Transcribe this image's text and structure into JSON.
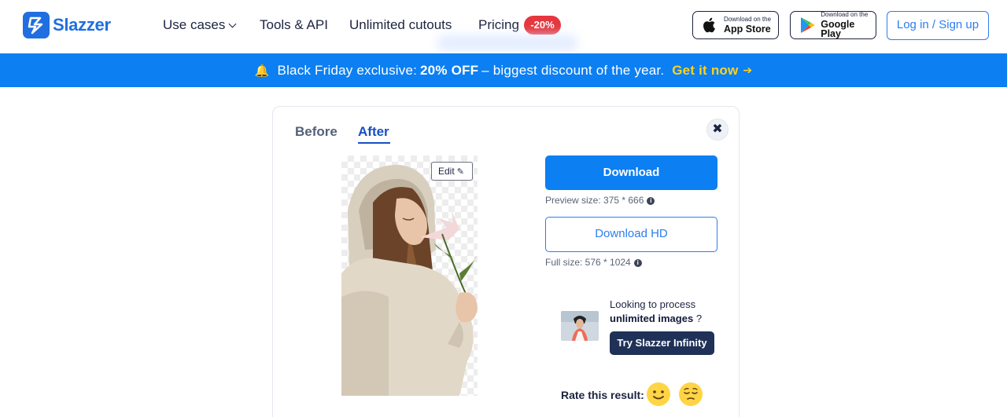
{
  "header": {
    "logo_text": "Slazzer",
    "nav": {
      "use_cases": "Use cases",
      "tools_api": "Tools & API",
      "unlimited_cutouts": "Unlimited cutouts",
      "pricing": "Pricing",
      "pricing_badge": "-20%"
    },
    "app_store": {
      "small": "Download on the",
      "big": "App Store"
    },
    "google_play": {
      "small": "Download on the",
      "big": "Google Play"
    },
    "login": "Log in / Sign up"
  },
  "banner": {
    "text_before": "Black Friday exclusive:",
    "highlight": "20% OFF",
    "text_after": "– biggest discount of the year.",
    "cta": "Get it now"
  },
  "card": {
    "tabs": {
      "before": "Before",
      "after": "After",
      "active": "After"
    },
    "close_icon": "✖",
    "edit_label": "Edit",
    "download_label": "Download",
    "preview_size": "Preview size: 375 * 666",
    "download_hd_label": "Download HD",
    "full_size": "Full size: 576 * 1024",
    "promo": {
      "line1": "Looking to process",
      "bold": "unlimited images",
      "suffix": " ?",
      "button": "Try Slazzer Infinity"
    },
    "rate_label": "Rate this result:"
  },
  "colors": {
    "brand_blue": "#0c7ff2",
    "badge_red": "#e5373f",
    "banner_cta": "#ffd21e",
    "dark_button": "#1f3157"
  }
}
